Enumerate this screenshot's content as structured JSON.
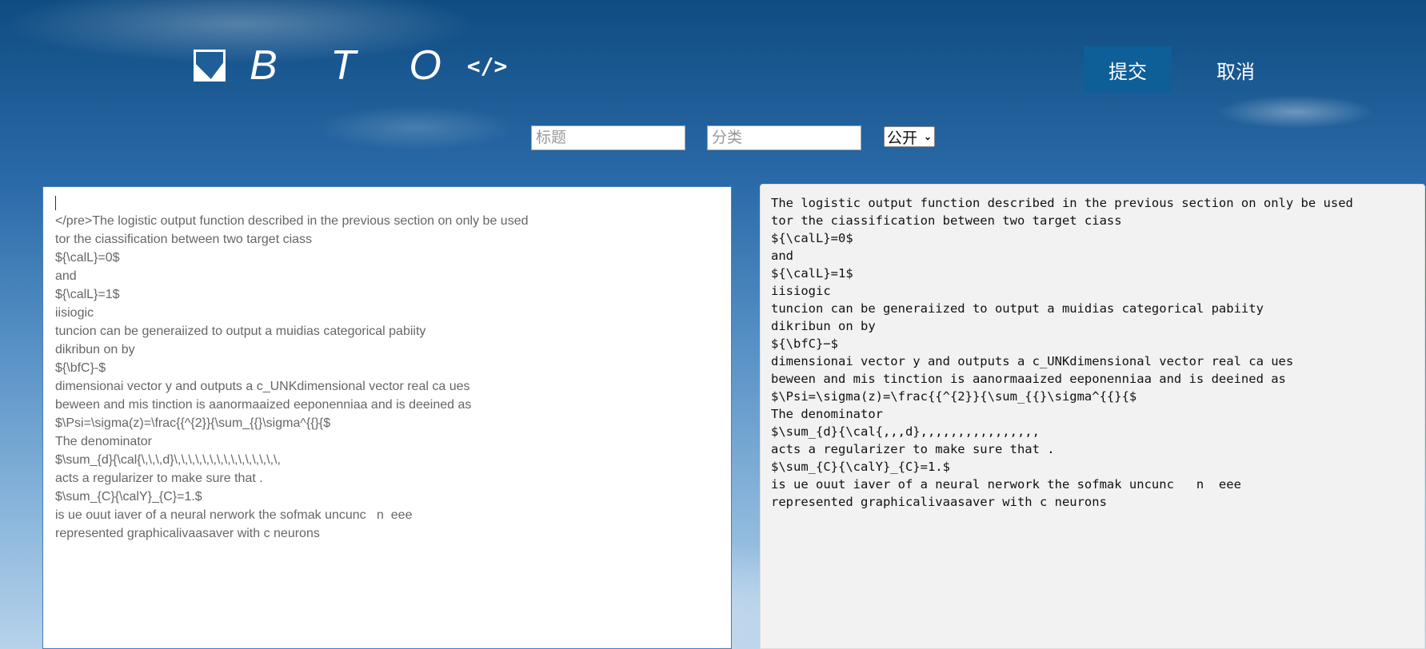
{
  "brand": {
    "logo_text": "B T O",
    "logo_icon": "image-icon",
    "code_icon": "</>"
  },
  "toolbar": {
    "submit_label": "提交",
    "cancel_label": "取消"
  },
  "form": {
    "title_placeholder": "标题",
    "category_placeholder": "分类",
    "visibility_selected": "公开"
  },
  "editor": {
    "lines": [
      "</pre>The logistic output function described in the previous section on only be used",
      "tor the ciassification between two target ciass",
      "${\\calL}=0$",
      "and",
      "${\\calL}=1$",
      "iisiogic",
      "tuncion can be generaiized to output a muidias categorical pabiity",
      "dikribun on by",
      "${\\bfC}-$",
      "dimensionai vector y and outputs a c_UNKdimensional vector real ca ues",
      "beween and mis tinction is aanormaaized eeponenniaa and is deeined as",
      "$\\Psi=\\sigma(z)=\\frac{{^{2}}{\\sum_{{}\\sigma^{{}{$",
      "The denominator",
      "$\\sum_{d}{\\cal{\\,\\,\\,d}\\,\\,\\,\\,\\,\\,\\,\\,\\,\\,\\,\\,\\,\\,\\,",
      "acts a regularizer to make sure that .",
      "$\\sum_{C}{\\calY}_{C}=1.$",
      "is ue ouut iaver of a neural nerwork the sofmak uncunc   n  eee",
      "represented graphicalivaasaver with c neurons"
    ]
  },
  "preview": {
    "lines": [
      "The logistic output function described in the previous section on only be used",
      "tor the ciassification between two target ciass",
      "${\\calL}=0$",
      "and",
      "${\\calL}=1$",
      "iisiogic",
      "tuncion can be generaiized to output a muidias categorical pabiity",
      "dikribun on by",
      "${\\bfC}−$",
      "dimensionai vector y and outputs a c_UNKdimensional vector real ca ues",
      "beween and mis tinction is aanormaaized eeponenniaa and is deeined as",
      "$\\Psi=\\sigma(z)=\\frac{{^{2}}{\\sum_{{}\\sigma^{{}{$",
      "The denominator",
      "$\\sum_{d}{\\cal{,,,d},,,,,,,,,,,,,,,,",
      "acts a regularizer to make sure that .",
      "$\\sum_{C}{\\calY}_{C}=1.$",
      "is ue ouut iaver of a neural nerwork the sofmak uncunc   n  eee",
      "represented graphicalivaasaver with c neurons"
    ]
  }
}
